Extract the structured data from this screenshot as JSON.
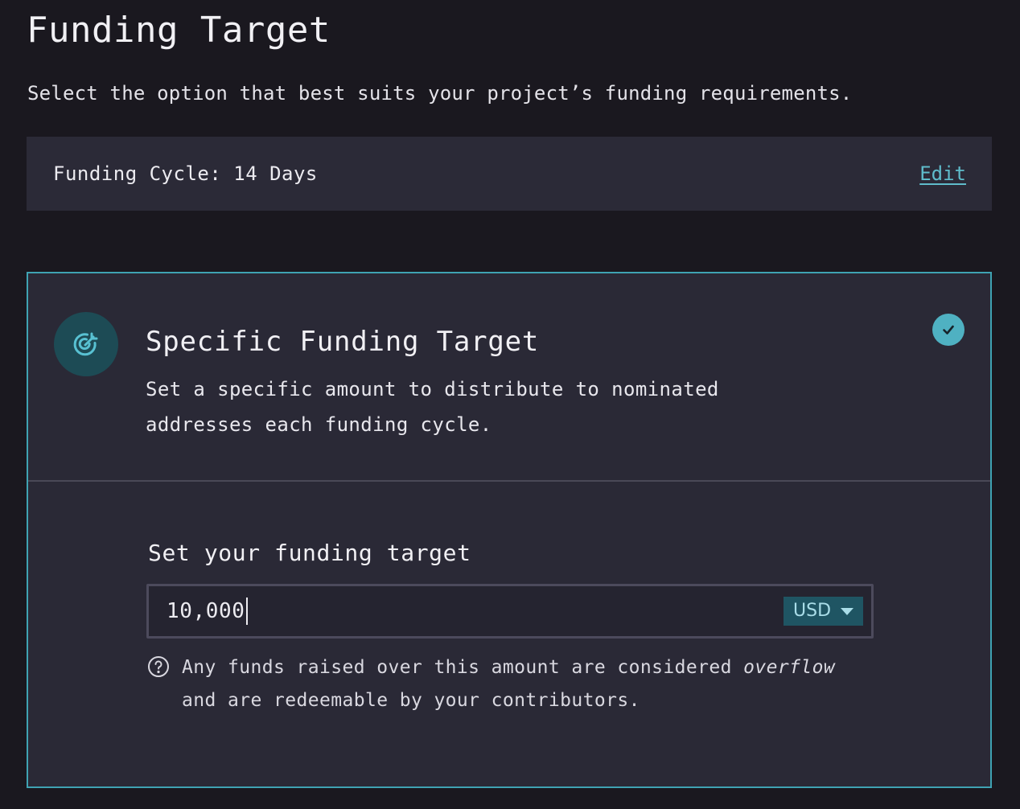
{
  "page": {
    "title": "Funding Target",
    "subtitle": "Select the option that best suits your project’s funding requirements."
  },
  "cycle": {
    "label": "Funding Cycle: 14 Days",
    "edit_label": "Edit"
  },
  "option": {
    "title": "Specific Funding Target",
    "description": "Set a specific amount to distribute to nominated addresses each funding cycle.",
    "selected": true,
    "icon": "target-icon"
  },
  "target": {
    "label": "Set your funding target",
    "amount": "10,000",
    "currency": "USD",
    "help_prefix": "Any funds raised over this amount are considered",
    "help_emphasis": "overflow",
    "help_suffix": "and are redeemable by your contributors."
  },
  "colors": {
    "accent": "#4fb1c2",
    "background": "#1a181f",
    "panel": "#2a2936"
  }
}
